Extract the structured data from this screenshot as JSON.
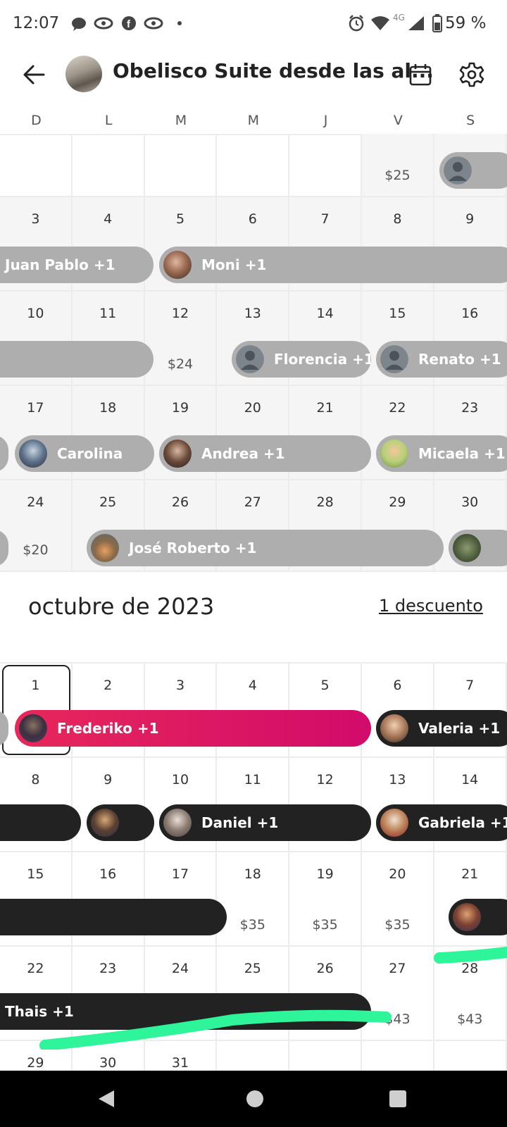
{
  "status_bar": {
    "time": "12:07",
    "network": "4G",
    "battery": "59 %"
  },
  "header": {
    "title": "Obelisco Suite desde las al..."
  },
  "weekdays": [
    "D",
    "L",
    "M",
    "M",
    "J",
    "V",
    "S"
  ],
  "month_title": "octubre de 2023",
  "discount_link": "1 descuento",
  "september_rows": [
    [
      "",
      "",
      "",
      "",
      "",
      "",
      ""
    ],
    [
      "3",
      "4",
      "5",
      "6",
      "7",
      "8",
      "9"
    ],
    [
      "10",
      "11",
      "12",
      "13",
      "14",
      "15",
      "16"
    ],
    [
      "17",
      "18",
      "19",
      "20",
      "21",
      "22",
      "23"
    ],
    [
      "24",
      "25",
      "26",
      "27",
      "28",
      "29",
      "30"
    ]
  ],
  "september_prices": {
    "r0c5": "$25",
    "r2c2": "$24",
    "r4c0": "$20"
  },
  "september_bookings": {
    "juan_pablo": "Juan Pablo +1",
    "moni": "Moni +1",
    "florencia": "Florencia +1",
    "renato": "Renato +1",
    "carolina": "Carolina",
    "andrea": "Andrea +1",
    "micaela": "Micaela +1",
    "jose_roberto": "José Roberto +1"
  },
  "october_rows": [
    [
      "1",
      "2",
      "3",
      "4",
      "5",
      "6",
      "7"
    ],
    [
      "8",
      "9",
      "10",
      "11",
      "12",
      "13",
      "14"
    ],
    [
      "15",
      "16",
      "17",
      "18",
      "19",
      "20",
      "21"
    ],
    [
      "22",
      "23",
      "24",
      "25",
      "26",
      "27",
      "28"
    ],
    [
      "29",
      "30",
      "31",
      "",
      "",
      "",
      ""
    ]
  ],
  "october_prices": {
    "r2c3": "$35",
    "r2c4": "$35",
    "r2c5": "$35",
    "r3c5": "$43",
    "r3c6": "$43"
  },
  "october_bookings": {
    "frederiko": "Frederiko +1",
    "valeria": "Valeria +1",
    "daniel": "Daniel +1",
    "gabriela": "Gabriela +1",
    "thais": "Thais +1"
  },
  "colors": {
    "accent": "#e8275a",
    "past_booking": "#aeaeae",
    "future_booking": "#222222",
    "highlight_stroke": "#2ef59a"
  }
}
